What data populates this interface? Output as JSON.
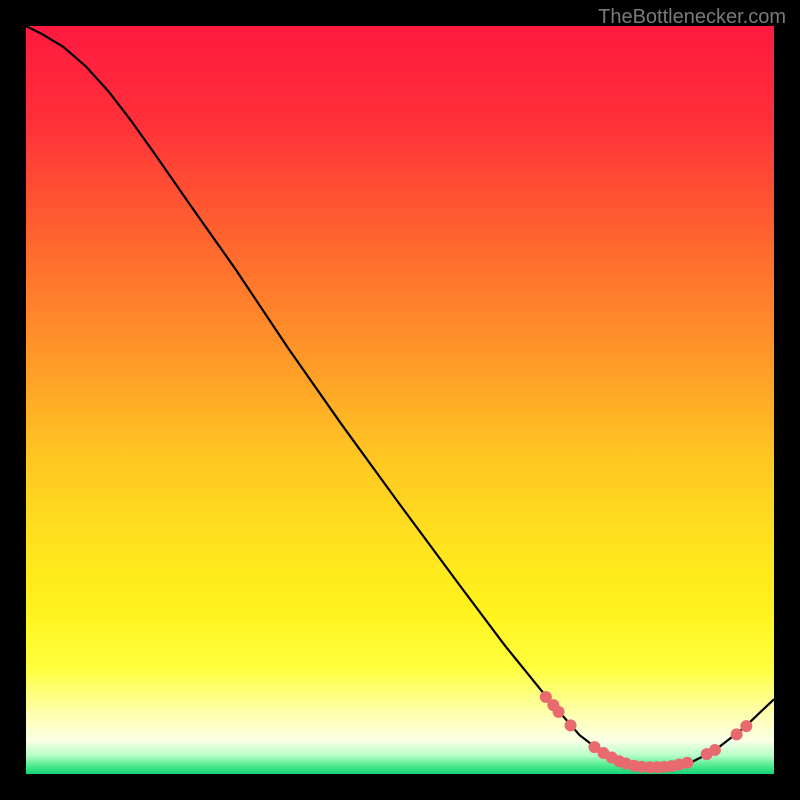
{
  "watermark": "TheBottlenecker.com",
  "chart_data": {
    "type": "line",
    "title": "",
    "xlabel": "",
    "ylabel": "",
    "xlim": [
      0,
      100
    ],
    "ylim": [
      0,
      100
    ],
    "gradient_stops": [
      {
        "offset": 0.0,
        "color": "#ff1a3f"
      },
      {
        "offset": 0.12,
        "color": "#ff2e3a"
      },
      {
        "offset": 0.3,
        "color": "#ff6a2e"
      },
      {
        "offset": 0.45,
        "color": "#ff9a28"
      },
      {
        "offset": 0.58,
        "color": "#ffc822"
      },
      {
        "offset": 0.7,
        "color": "#ffe41e"
      },
      {
        "offset": 0.78,
        "color": "#fff31c"
      },
      {
        "offset": 0.86,
        "color": "#ffff40"
      },
      {
        "offset": 0.92,
        "color": "#ffffb0"
      },
      {
        "offset": 0.955,
        "color": "#fbffe6"
      },
      {
        "offset": 0.975,
        "color": "#b8ffc8"
      },
      {
        "offset": 0.99,
        "color": "#45e88a"
      },
      {
        "offset": 1.0,
        "color": "#17d276"
      }
    ],
    "curve": [
      {
        "x": 0.0,
        "y": 100.0
      },
      {
        "x": 2.0,
        "y": 99.0
      },
      {
        "x": 5.0,
        "y": 97.2
      },
      {
        "x": 8.0,
        "y": 94.6
      },
      {
        "x": 11.0,
        "y": 91.3
      },
      {
        "x": 14.0,
        "y": 87.4
      },
      {
        "x": 17.0,
        "y": 83.2
      },
      {
        "x": 22.0,
        "y": 76.0
      },
      {
        "x": 28.0,
        "y": 67.5
      },
      {
        "x": 35.0,
        "y": 57.0
      },
      {
        "x": 42.0,
        "y": 47.0
      },
      {
        "x": 50.0,
        "y": 36.0
      },
      {
        "x": 58.0,
        "y": 25.2
      },
      {
        "x": 64.0,
        "y": 17.2
      },
      {
        "x": 70.0,
        "y": 9.8
      },
      {
        "x": 74.0,
        "y": 5.2
      },
      {
        "x": 77.0,
        "y": 2.9
      },
      {
        "x": 80.0,
        "y": 1.5
      },
      {
        "x": 83.0,
        "y": 0.9
      },
      {
        "x": 86.0,
        "y": 0.9
      },
      {
        "x": 89.0,
        "y": 1.6
      },
      {
        "x": 92.0,
        "y": 3.1
      },
      {
        "x": 96.0,
        "y": 6.2
      },
      {
        "x": 100.0,
        "y": 10.0
      }
    ],
    "markers": [
      {
        "x": 69.5,
        "y": 10.3
      },
      {
        "x": 70.5,
        "y": 9.2
      },
      {
        "x": 71.2,
        "y": 8.3
      },
      {
        "x": 72.8,
        "y": 6.5
      },
      {
        "x": 76.0,
        "y": 3.6
      },
      {
        "x": 77.2,
        "y": 2.8
      },
      {
        "x": 78.3,
        "y": 2.2
      },
      {
        "x": 79.3,
        "y": 1.7
      },
      {
        "x": 80.2,
        "y": 1.4
      },
      {
        "x": 81.3,
        "y": 1.1
      },
      {
        "x": 82.3,
        "y": 0.95
      },
      {
        "x": 83.4,
        "y": 0.9
      },
      {
        "x": 84.4,
        "y": 0.9
      },
      {
        "x": 85.3,
        "y": 0.95
      },
      {
        "x": 86.3,
        "y": 1.05
      },
      {
        "x": 87.3,
        "y": 1.25
      },
      {
        "x": 88.4,
        "y": 1.5
      },
      {
        "x": 91.0,
        "y": 2.65
      },
      {
        "x": 92.1,
        "y": 3.2
      },
      {
        "x": 95.0,
        "y": 5.3
      },
      {
        "x": 96.3,
        "y": 6.4
      }
    ],
    "marker_style": {
      "fill": "#e86a6f",
      "radius_px": 6
    }
  }
}
